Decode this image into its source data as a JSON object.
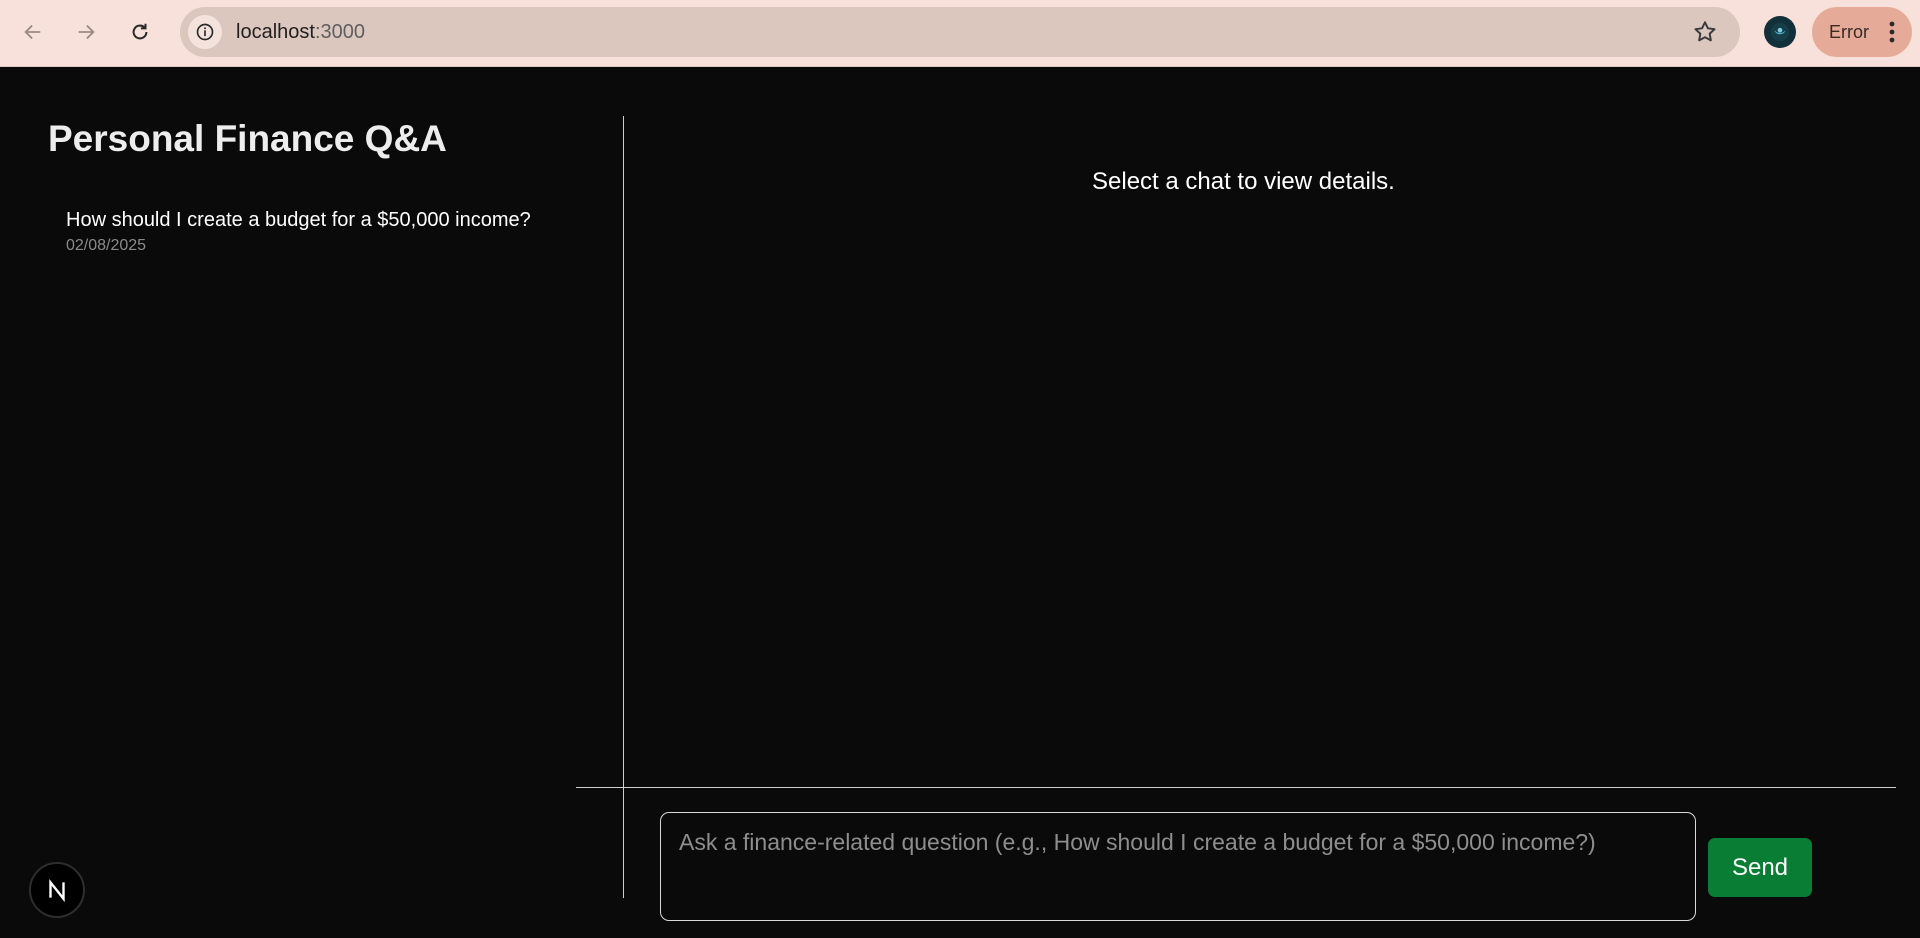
{
  "browser": {
    "url_host": "localhost",
    "url_port": ":3000",
    "error_label": "Error",
    "icons": [
      "back-arrow-icon",
      "forward-arrow-icon",
      "reload-icon",
      "site-info-icon",
      "bookmark-star-icon",
      "profile-avatar-icon",
      "more-vert-icon"
    ]
  },
  "app": {
    "title": "Personal Finance Q&A",
    "chats": [
      {
        "question": "How should I create a budget for a $50,000 income?",
        "date": "02/08/2025"
      }
    ],
    "empty_state": "Select a chat to view details.",
    "input": {
      "placeholder": "Ask a finance-related question (e.g., How should I create a budget for a $50,000 income?)",
      "value": ""
    },
    "send_label": "Send",
    "dev_badge_icon": "nextjs-logo-icon"
  },
  "colors": {
    "background": "#0a0a0a",
    "send_button": "#0a7d34",
    "browser_toolbar": "#f7e1da",
    "error_pill": "#e6ab98"
  }
}
